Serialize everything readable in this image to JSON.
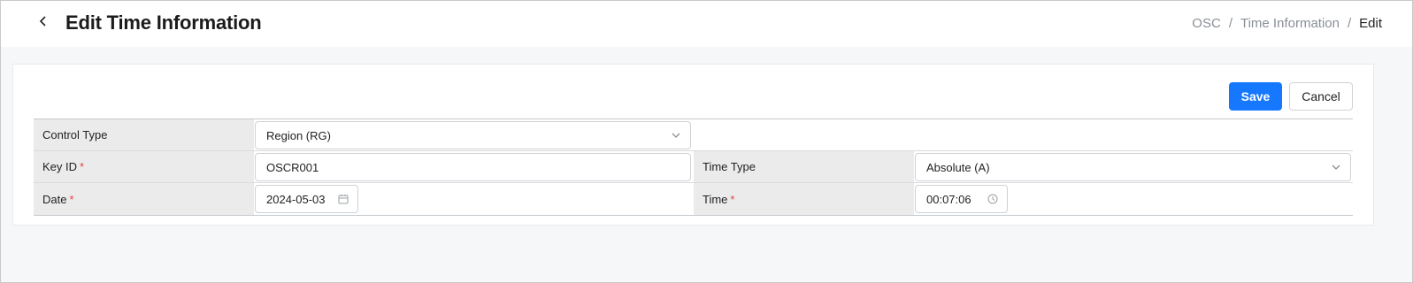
{
  "header": {
    "title": "Edit Time Information",
    "breadcrumb": [
      "OSC",
      "Time Information",
      "Edit"
    ]
  },
  "actions": {
    "save_label": "Save",
    "cancel_label": "Cancel"
  },
  "form": {
    "control_type": {
      "label": "Control Type",
      "value": "Region (RG)"
    },
    "key_id": {
      "label": "Key ID",
      "value": "OSCR001",
      "required": "*"
    },
    "time_type": {
      "label": "Time Type",
      "value": "Absolute (A)"
    },
    "date": {
      "label": "Date",
      "value": "2024-05-03",
      "required": "*"
    },
    "time": {
      "label": "Time",
      "value": "00:07:06",
      "required": "*"
    }
  },
  "colors": {
    "primary": "#1677ff",
    "required": "#e54545",
    "label_bg": "#ebebeb"
  },
  "icons": [
    "chevron-left-icon",
    "chevron-down-icon",
    "calendar-icon",
    "clock-icon"
  ]
}
